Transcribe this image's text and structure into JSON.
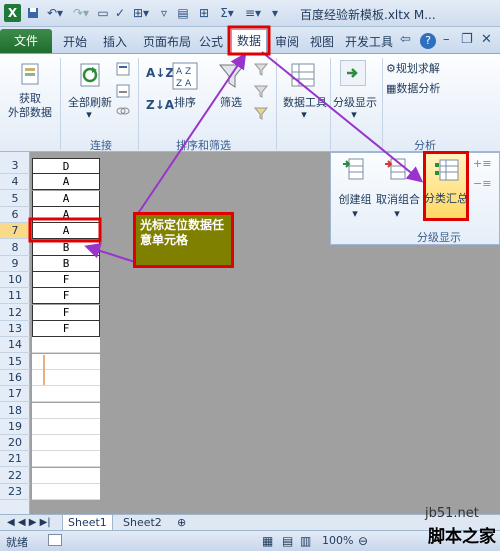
{
  "window": {
    "title": "百度经验新模板.xltx M..."
  },
  "tabs": [
    "文件",
    "开始",
    "插入",
    "页面布局",
    "公式",
    "数据",
    "审阅",
    "视图",
    "开发工具"
  ],
  "ribbon": {
    "get_external": "获取\n外部数据",
    "refresh_all": "全部刷新",
    "sort": "排序",
    "filter": "筛选",
    "data_tools": "数据工具",
    "outline": "分级显示",
    "solver": "规划求解",
    "analysis": "数据分析",
    "groups": {
      "connections": "连接",
      "sort_filter": "排序和筛选",
      "analyze": "分析"
    }
  },
  "panel": {
    "group": "创建组",
    "ungroup": "取消组合",
    "subtotal": "分类汇总",
    "label": "分级显示"
  },
  "callout": {
    "text": "光标定位数据任意单元格"
  },
  "rows": [
    "3",
    "4",
    "5",
    "6",
    "7",
    "8",
    "9",
    "10",
    "11",
    "12",
    "13",
    "14",
    "15",
    "16",
    "17",
    "18",
    "19",
    "20",
    "21",
    "22",
    "23"
  ],
  "cells": [
    "D",
    "A",
    "A",
    "A",
    "A",
    "B",
    "B",
    "F",
    "F",
    "F",
    "F"
  ],
  "active_row": "7",
  "sheets": [
    "Sheet1",
    "Sheet2"
  ],
  "status": {
    "ready": "就绪",
    "zoom": "100%"
  },
  "watermark": {
    "site": "jb51.net",
    "name": "脚本之家"
  },
  "colors": {
    "accent": "#e00000",
    "arrow": "#9933cc",
    "callout_bg": "#808000"
  }
}
